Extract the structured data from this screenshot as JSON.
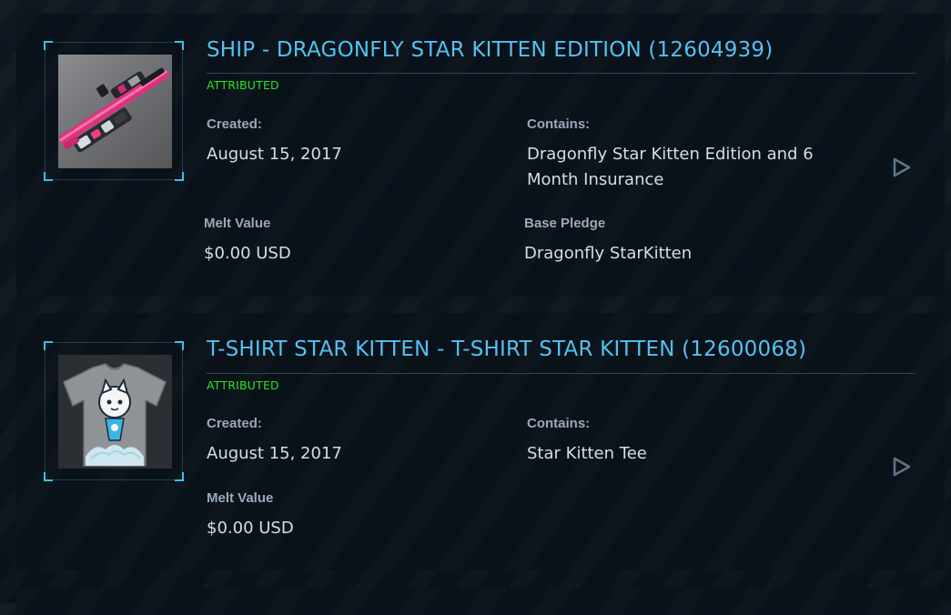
{
  "pledges": [
    {
      "title": "SHIP - DRAGONFLY STAR KITTEN EDITION (12604939)",
      "status": "ATTRIBUTED",
      "created_label": "Created:",
      "created_value": "August 15, 2017",
      "contains_label": "Contains:",
      "contains_value": "Dragonfly Star Kitten Edition and 6 Month Insurance",
      "melt_label": "Melt Value",
      "melt_value": "$0.00 USD",
      "base_label": "Base Pledge",
      "base_value": "Dragonfly StarKitten",
      "thumbnail": "dragonfly-ship-image",
      "action_icon": "play-triangle-icon"
    },
    {
      "title": "T-SHIRT STAR KITTEN - T-SHIRT STAR KITTEN (12600068)",
      "status": "ATTRIBUTED",
      "created_label": "Created:",
      "created_value": "August 15, 2017",
      "contains_label": "Contains:",
      "contains_value": "Star Kitten Tee",
      "melt_label": "Melt Value",
      "melt_value": "$0.00 USD",
      "thumbnail": "star-kitten-tshirt-image",
      "action_icon": "play-triangle-icon"
    }
  ],
  "colors": {
    "title": "#52c2f0",
    "status": "#27e61e",
    "label": "#9aa9b9",
    "value": "#d6dde5",
    "accent": "#36c3e4",
    "card_bg": "#0a1119"
  }
}
